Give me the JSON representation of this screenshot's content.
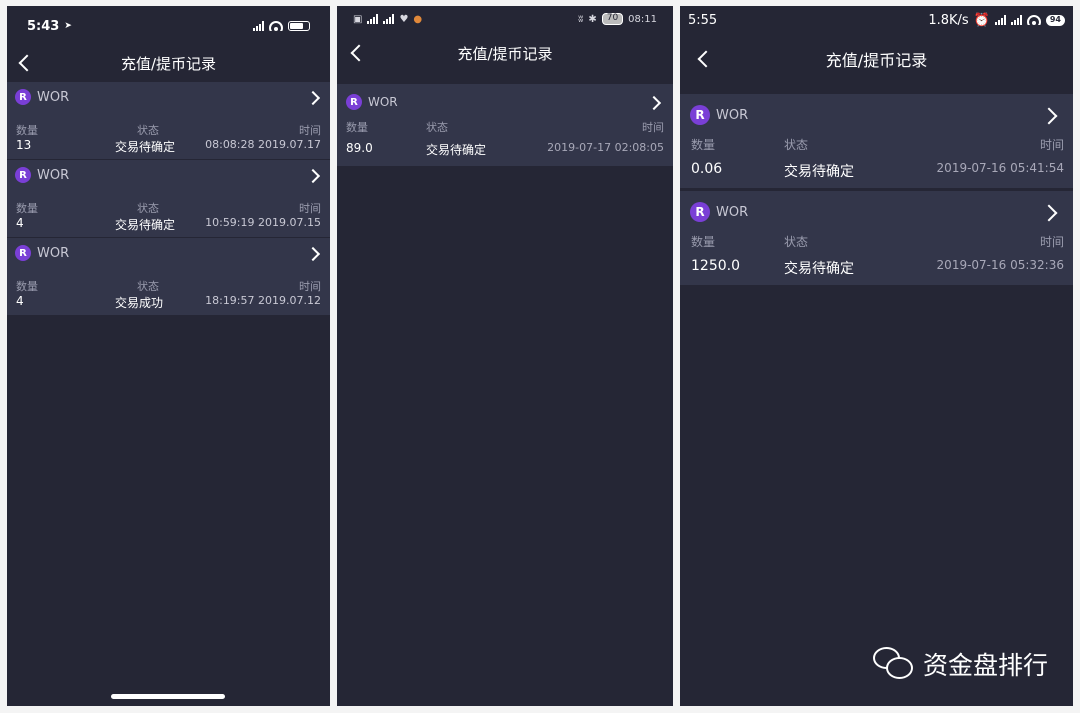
{
  "screens": [
    {
      "status": {
        "time": "5:43"
      },
      "title": "充值/提币记录",
      "labels": {
        "qty": "数量",
        "state": "状态",
        "time": "时间"
      },
      "records": [
        {
          "coin": "WOR",
          "qty": "13",
          "state": "交易待确定",
          "time": "08:08:28 2019.07.17"
        },
        {
          "coin": "WOR",
          "qty": "4",
          "state": "交易待确定",
          "time": "10:59:19 2019.07.15"
        },
        {
          "coin": "WOR",
          "qty": "4",
          "state": "交易成功",
          "time": "18:19:57 2019.07.12"
        }
      ]
    },
    {
      "status": {
        "time": "08:11",
        "battery": "70"
      },
      "title": "充值/提币记录",
      "labels": {
        "qty": "数量",
        "state": "状态",
        "time": "时间"
      },
      "records": [
        {
          "coin": "WOR",
          "qty": "89.0",
          "state": "交易待确定",
          "time": "2019-07-17 02:08:05"
        }
      ]
    },
    {
      "status": {
        "time": "5:55",
        "speed": "1.8K/s",
        "battery": "94"
      },
      "title": "充值/提币记录",
      "labels": {
        "qty": "数量",
        "state": "状态",
        "time": "时间"
      },
      "records": [
        {
          "coin": "WOR",
          "qty": "0.06",
          "state": "交易待确定",
          "time": "2019-07-16 05:41:54"
        },
        {
          "coin": "WOR",
          "qty": "1250.0",
          "state": "交易待确定",
          "time": "2019-07-16 05:32:36"
        }
      ]
    }
  ],
  "watermark": {
    "text": "资金盘排行",
    "icon": "wechat-icon"
  }
}
